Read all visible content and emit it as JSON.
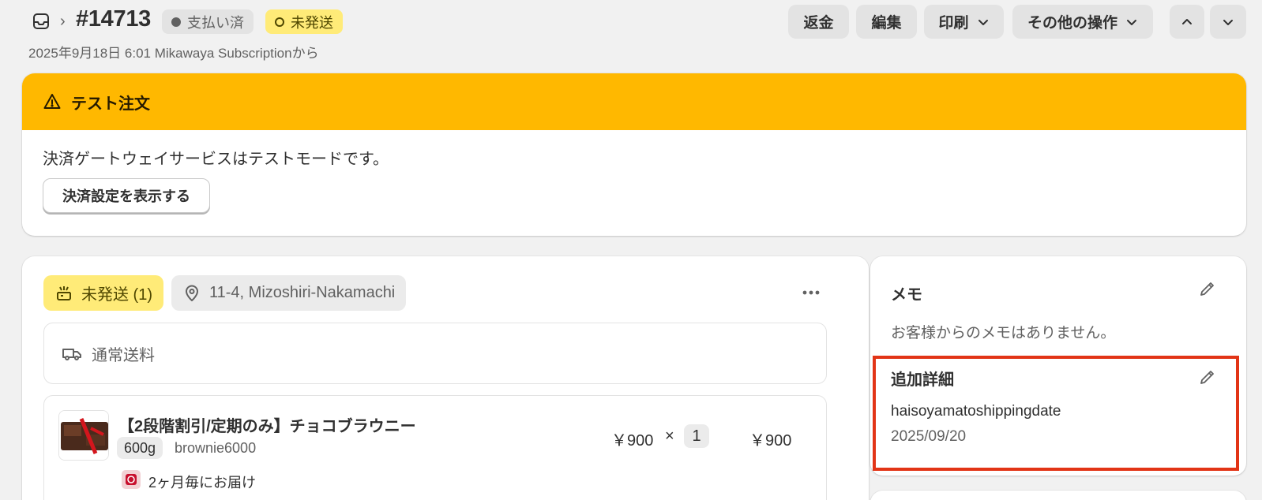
{
  "header": {
    "back_icon": "inbox-icon",
    "order_number": "#14713",
    "payment_status": "支払い済",
    "fulfillment_status": "未発送",
    "subtitle": "2025年9月18日 6:01 Mikawaya Subscriptionから",
    "buttons": {
      "refund": "返金",
      "edit": "編集",
      "print": "印刷",
      "more_actions": "その他の操作"
    }
  },
  "test_banner": {
    "title": "テスト注文",
    "message": "決済ゲートウェイサービスはテストモードです。",
    "button": "決済設定を表示する",
    "color": "#ffb800"
  },
  "fulfillment": {
    "status_label": "未発送 (1)",
    "location": "11-4, Mizoshiri-Nakamachi",
    "shipping_method": "通常送料",
    "item": {
      "title": "【2段階割引/定期のみ】チョコブラウニー",
      "variant": "600g",
      "sku": "brownie6000",
      "subscription": "2ヶ月毎にお届け",
      "unit_price": "￥900",
      "times": "×",
      "quantity": "1",
      "total": "￥900"
    }
  },
  "notes": {
    "title": "メモ",
    "empty_text": "お客様からのメモはありません。"
  },
  "additional_details": {
    "title": "追加詳細",
    "key": "haisoyamatoshippingdate",
    "value": "2025/09/20",
    "highlight_color": "#e23416"
  }
}
